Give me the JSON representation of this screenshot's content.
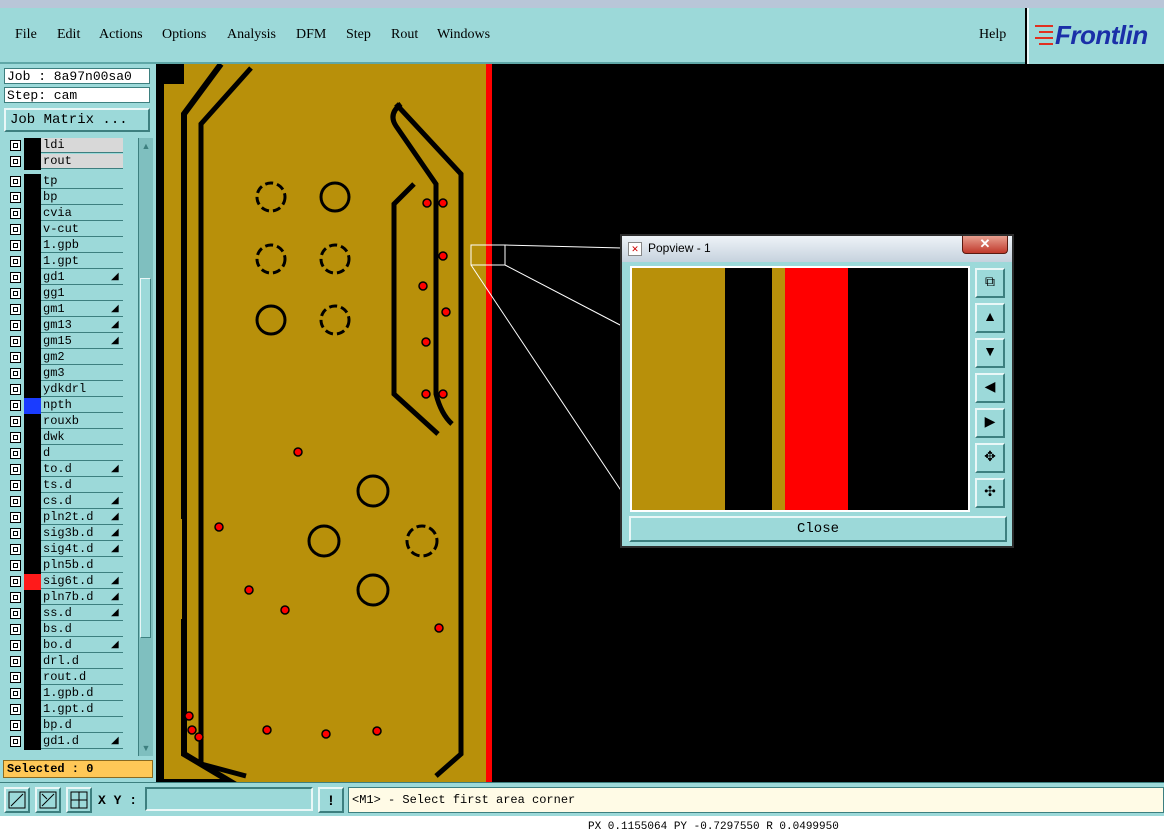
{
  "menu": {
    "items": [
      {
        "label": "File"
      },
      {
        "label": "Edit"
      },
      {
        "label": "Actions"
      },
      {
        "label": "Options"
      },
      {
        "label": "Analysis"
      },
      {
        "label": "DFM"
      },
      {
        "label": "Step"
      },
      {
        "label": "Rout"
      },
      {
        "label": "Windows"
      }
    ],
    "help": "Help"
  },
  "brand": {
    "name": "Frontlin"
  },
  "job": {
    "label": "Job : 8a97n00sa0",
    "step": "Step: cam",
    "matrix_button": "Job Matrix ..."
  },
  "layers": [
    {
      "name": "ldi",
      "selected": true,
      "color": ""
    },
    {
      "name": "rout",
      "selected": true,
      "color": ""
    },
    {
      "name": "tp",
      "color": ""
    },
    {
      "name": "bp",
      "color": ""
    },
    {
      "name": "cvia",
      "color": ""
    },
    {
      "name": "v-cut",
      "color": ""
    },
    {
      "name": "1.gpb",
      "color": ""
    },
    {
      "name": "1.gpt",
      "color": ""
    },
    {
      "name": "gd1",
      "flag": true,
      "color": ""
    },
    {
      "name": "gg1",
      "color": ""
    },
    {
      "name": "gm1",
      "flag": true,
      "color": ""
    },
    {
      "name": "gm13",
      "flag": true,
      "color": ""
    },
    {
      "name": "gm15",
      "flag": true,
      "color": ""
    },
    {
      "name": "gm2",
      "color": ""
    },
    {
      "name": "gm3",
      "color": ""
    },
    {
      "name": "ydkdrl",
      "color": ""
    },
    {
      "name": "npth",
      "color": "#1a3cff"
    },
    {
      "name": "rouxb",
      "color": ""
    },
    {
      "name": "dwk",
      "color": ""
    },
    {
      "name": "d",
      "color": ""
    },
    {
      "name": "to.d",
      "flag": true,
      "color": ""
    },
    {
      "name": "ts.d",
      "color": ""
    },
    {
      "name": "cs.d",
      "flag": true,
      "color": ""
    },
    {
      "name": "pln2t.d",
      "flag": true,
      "color": ""
    },
    {
      "name": "sig3b.d",
      "flag": true,
      "color": ""
    },
    {
      "name": "sig4t.d",
      "flag": true,
      "color": ""
    },
    {
      "name": "pln5b.d",
      "color": ""
    },
    {
      "name": "sig6t.d",
      "flag": true,
      "color": "#ff1a1a"
    },
    {
      "name": "pln7b.d",
      "flag": true,
      "color": ""
    },
    {
      "name": "ss.d",
      "flag": true,
      "color": ""
    },
    {
      "name": "bs.d",
      "color": ""
    },
    {
      "name": "bo.d",
      "flag": true,
      "color": ""
    },
    {
      "name": "drl.d",
      "color": ""
    },
    {
      "name": "rout.d",
      "color": ""
    },
    {
      "name": "1.gpb.d",
      "color": ""
    },
    {
      "name": "1.gpt.d",
      "color": ""
    },
    {
      "name": "bp.d",
      "color": ""
    },
    {
      "name": "gd1.d",
      "flag": true,
      "color": ""
    }
  ],
  "selected_count": "Selected : 0",
  "status": {
    "xy_label": "X Y :",
    "xy_value": "",
    "bang": "!",
    "prompt": "<M1> - Select first area corner"
  },
  "coords": "PX 0.1155064 PY -0.7297550 R 0.0499950",
  "popup": {
    "title": "Popview - 1",
    "close_x": "✕",
    "close_button": "Close"
  },
  "colors": {
    "copper": "#b8900a",
    "red": "#ff0000",
    "ui_bg": "#9cd9d9",
    "canvas_bg": "#000000"
  }
}
